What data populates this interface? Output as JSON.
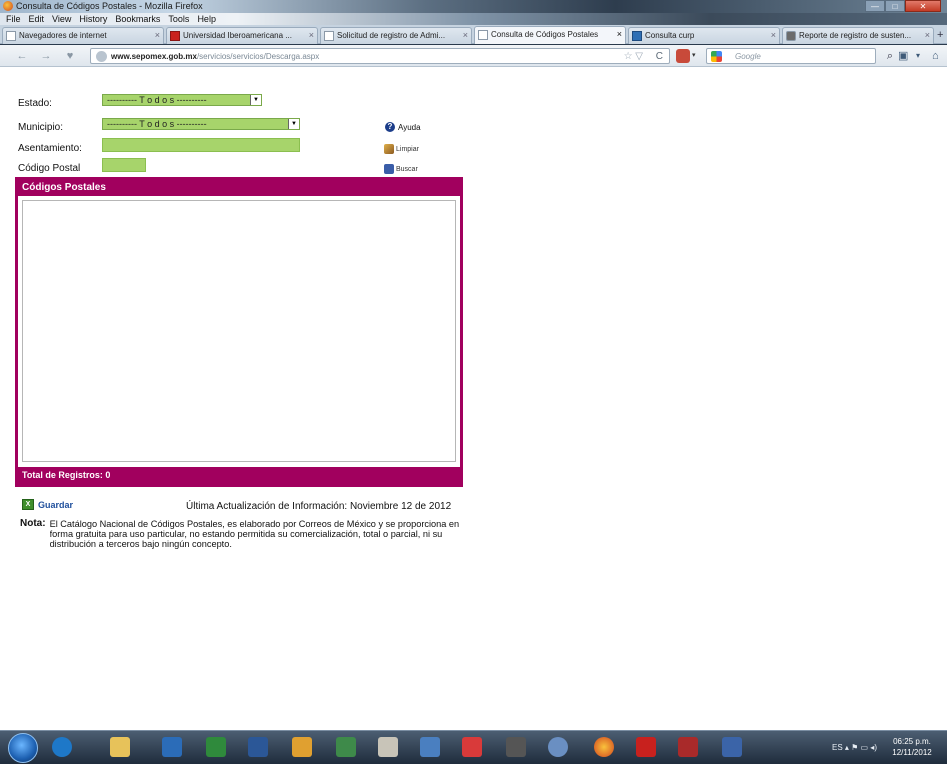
{
  "window": {
    "title": "Consulta de Códigos Postales - Mozilla Firefox"
  },
  "menu": [
    "File",
    "Edit",
    "View",
    "History",
    "Bookmarks",
    "Tools",
    "Help"
  ],
  "tabs": [
    {
      "label": "Navegadores de internet",
      "icon": "blank-page-icon",
      "active": false
    },
    {
      "label": "Universidad Iberoamericana ...",
      "icon": "ibero-favicon",
      "active": false
    },
    {
      "label": "Solicitud de registro de Admi...",
      "icon": "blank-page-icon",
      "active": false
    },
    {
      "label": "Consulta de Códigos Postales",
      "icon": "blank-page-icon",
      "active": true
    },
    {
      "label": "Consulta curp",
      "icon": "curp-favicon",
      "active": false
    },
    {
      "label": "Reporte de registro de susten...",
      "icon": "puzzle-icon",
      "active": false
    }
  ],
  "nav": {
    "url_domain": "www.sepomex.gob.mx",
    "url_path": "/servicios/servicios/Descarga.aspx",
    "search_placeholder": "Google"
  },
  "form": {
    "estado_label": "Estado:",
    "estado_value": "---------- T o d o s ----------",
    "municipio_label": "Municipio:",
    "municipio_value": "---------- T o d o s ----------",
    "asentamiento_label": "Asentamiento:",
    "cp_label": "Código Postal",
    "help_label": "Ayuda",
    "clear_label": "Limpiar",
    "search_label": "Buscar"
  },
  "results": {
    "title": "Códigos Postales",
    "total_label": "Total de Registros: 0"
  },
  "footer": {
    "save_label": "Guardar",
    "updated": "Última Actualización de Información: Noviembre 12 de 2012",
    "nota_key": "Nota:",
    "nota_text": "El Catálogo Nacional de Códigos Postales, es elaborado por Correos de México y se proporciona en forma gratuita para uso particular, no estando permitida su comercialización, total o parcial, ni su distribución a terceros bajo ningún concepto."
  },
  "taskbar": {
    "lang": "ES",
    "time": "06:25 p.m.",
    "date": "12/11/2012"
  },
  "colors": {
    "accent": "#a1005e",
    "field": "#a7d46b",
    "link": "#1f4f9c"
  }
}
